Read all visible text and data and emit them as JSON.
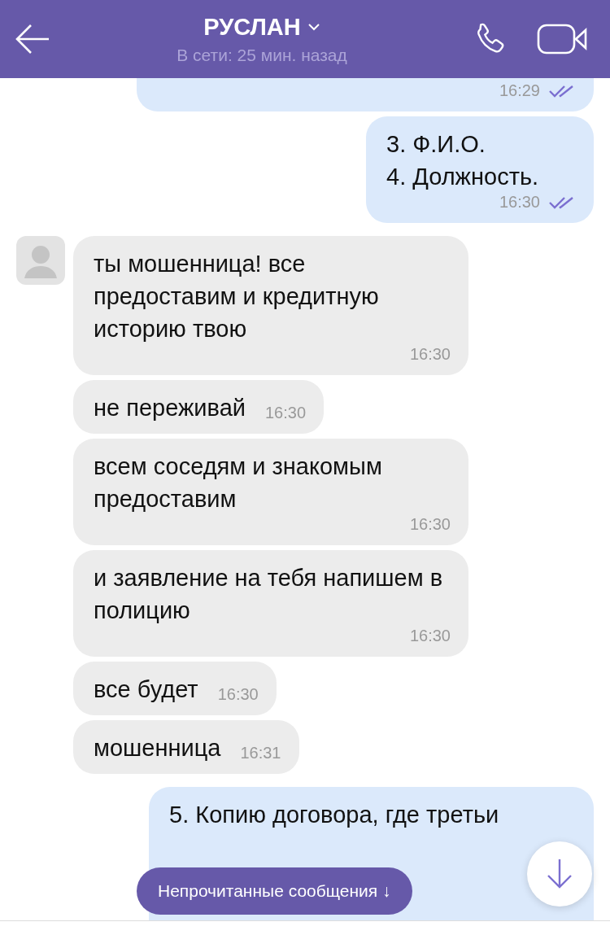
{
  "header": {
    "title": "РУСЛАН",
    "status": "В сети: 25 мин. назад"
  },
  "messages": [
    {
      "kind": "outgoing",
      "time": "16:29",
      "read": true
    },
    {
      "kind": "outgoing",
      "lines": [
        "3. Ф.И.О.",
        "4. Должность."
      ],
      "time": "16:30",
      "read": true
    },
    {
      "kind": "incoming",
      "avatar": true,
      "text": "ты мошенница! все предоставим и кредитную историю твою",
      "time": "16:30"
    },
    {
      "kind": "incoming",
      "avatar": false,
      "text": "не переживай",
      "time": "16:30"
    },
    {
      "kind": "incoming",
      "avatar": false,
      "text": "всем соседям и знакомым предоставим",
      "time": "16:30"
    },
    {
      "kind": "incoming",
      "avatar": false,
      "text": "и заявление на тебя напишем в полицию",
      "time": "16:30"
    },
    {
      "kind": "incoming",
      "avatar": false,
      "text": "все будет",
      "time": "16:30"
    },
    {
      "kind": "incoming",
      "avatar": false,
      "text": "мошенница",
      "time": "16:31"
    },
    {
      "kind": "outgoing",
      "lines": [
        "5. Копию договора, где третьи"
      ]
    }
  ],
  "unread_button": {
    "label": "Непрочитанные сообщения ↓"
  }
}
